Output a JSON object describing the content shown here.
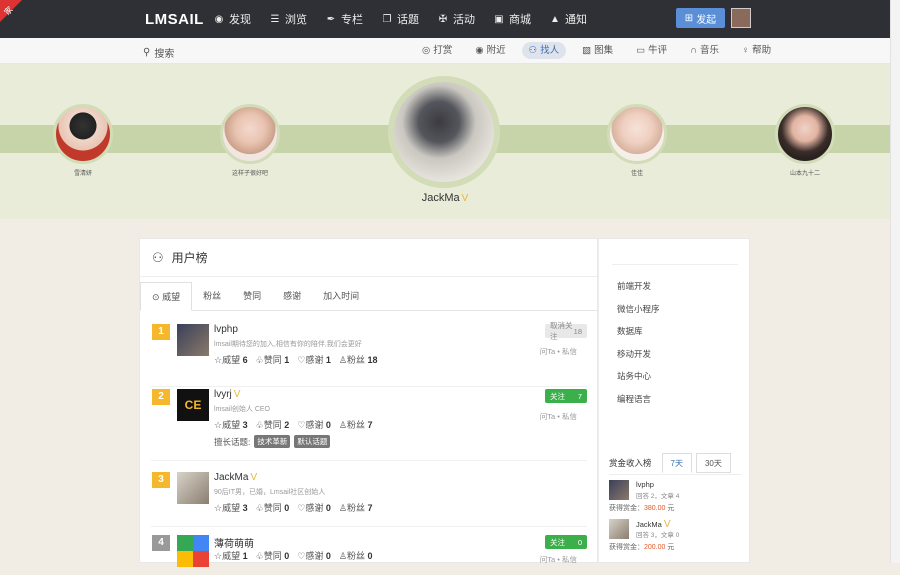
{
  "corner_badge": "家",
  "topbar": {
    "logo": "LMSAIL",
    "nav": [
      {
        "icon": "eye-icon",
        "label": "发现"
      },
      {
        "icon": "list-icon",
        "label": "浏览"
      },
      {
        "icon": "pen-icon",
        "label": "专栏"
      },
      {
        "icon": "chat-icon",
        "label": "话题"
      },
      {
        "icon": "activity-icon",
        "label": "活动"
      },
      {
        "icon": "cart-icon",
        "label": "商城"
      },
      {
        "icon": "bell-icon",
        "label": "通知"
      }
    ],
    "publish_label": "发起"
  },
  "subbar": {
    "search_label": "搜索",
    "links": [
      {
        "icon": "target-icon",
        "label": "打赏"
      },
      {
        "icon": "pin-icon",
        "label": "附近"
      },
      {
        "icon": "users-icon",
        "label": "找人",
        "active": true
      },
      {
        "icon": "image-icon",
        "label": "图集"
      },
      {
        "icon": "note-icon",
        "label": "牛评"
      },
      {
        "icon": "headphones-icon",
        "label": "音乐"
      },
      {
        "icon": "bulb-icon",
        "label": "帮助"
      }
    ]
  },
  "featured": {
    "left2": "雪清妍",
    "left1": "这样子很好吧",
    "center": "JackMa",
    "right1": "佳佳",
    "right2": "山本九十二"
  },
  "main": {
    "title": "用户榜",
    "tabs": [
      "威望",
      "粉丝",
      "赞同",
      "感谢",
      "加入时间"
    ],
    "users": [
      {
        "rank": "1",
        "name": "lvphp",
        "desc": "lmsail期待您的加入,相信有你的陪伴,我们会更好",
        "prestige": "6",
        "agree": "1",
        "thanks": "1",
        "fans": "18",
        "follow_label": "取消关注",
        "follow_count": "18",
        "follow_state": "done",
        "verified": false
      },
      {
        "rank": "2",
        "name": "lvyrj",
        "desc": "lmsail创始人 CEO",
        "prestige": "3",
        "agree": "2",
        "thanks": "0",
        "fans": "7",
        "follow_label": "关注",
        "follow_count": "7",
        "follow_state": "on",
        "verified": true,
        "tags_label": "擅长话题:",
        "tags": [
          "技术革新",
          "默认话题"
        ]
      },
      {
        "rank": "3",
        "name": "JackMa",
        "desc": "90后IT男，已婚，Lmsail社区创始人",
        "prestige": "3",
        "agree": "0",
        "thanks": "0",
        "fans": "7",
        "verified": true
      },
      {
        "rank": "4",
        "name": "薄荷萌萌",
        "desc": "",
        "prestige": "1",
        "agree": "0",
        "thanks": "0",
        "fans": "0",
        "follow_label": "关注",
        "follow_count": "0",
        "follow_state": "on",
        "verified": false
      }
    ],
    "labels": {
      "prestige": "威望",
      "agree": "赞同",
      "thanks": "感谢",
      "fans": "粉丝",
      "ask": "问Ta",
      "dot": "•",
      "msg": "私信"
    }
  },
  "side": {
    "items": [
      "前端开发",
      "微信小程序",
      "数据库",
      "移动开发",
      "站务中心",
      "编程语言"
    ],
    "income": {
      "title": "赏金收入榜",
      "tabs": [
        "7天",
        "30天"
      ],
      "rows": [
        {
          "name": "lvphp",
          "meta": "回答 2，文章 4",
          "label": "获得赏金：",
          "amount": "380.00",
          "unit": "元"
        },
        {
          "name": "JackMa",
          "meta": "回答 3，文章 0",
          "label": "获得赏金：",
          "amount": "200.00",
          "unit": "元"
        }
      ]
    }
  }
}
